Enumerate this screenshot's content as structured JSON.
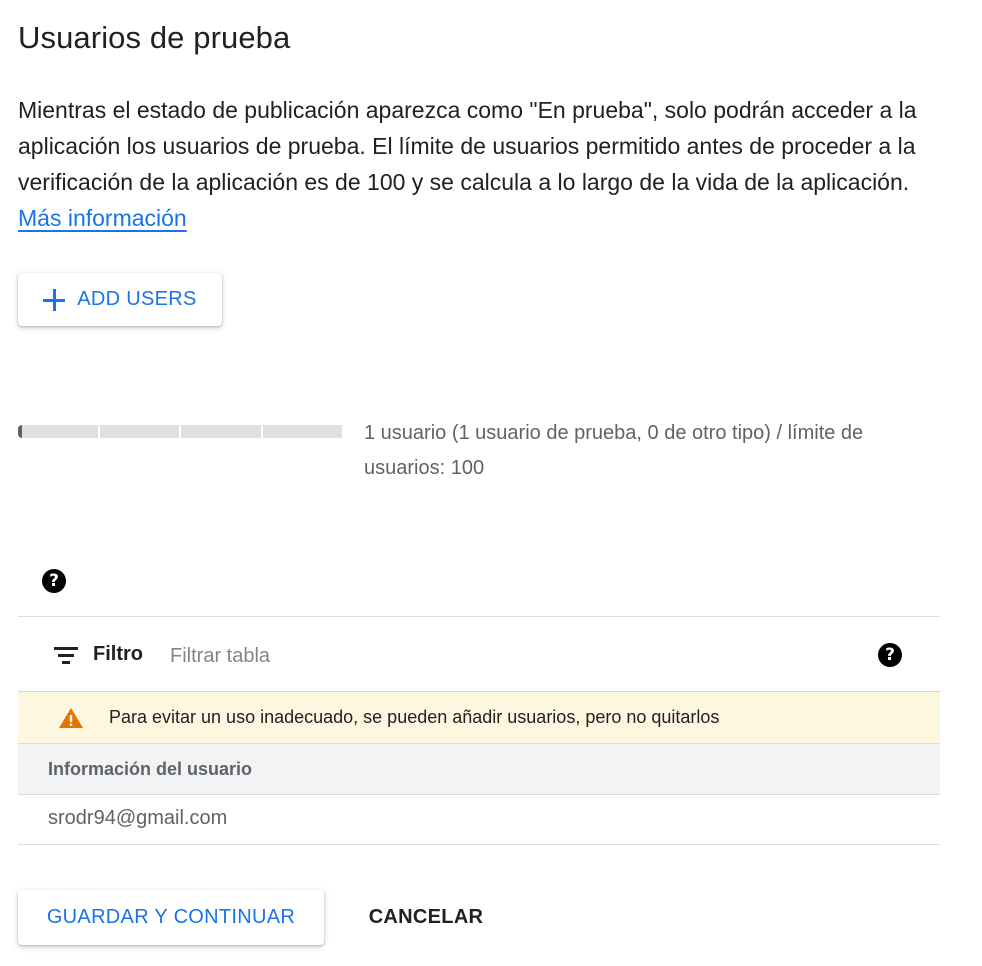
{
  "page": {
    "title": "Usuarios de prueba",
    "description": "Mientras el estado de publicación aparezca como \"En prueba\", solo podrán acceder a la aplicación los usuarios de prueba. El límite de usuarios permitido antes de proceder a la verificación de la aplicación es de 100 y se calcula a lo largo de la vida de la aplicación.",
    "learn_more_link": "Más información"
  },
  "actions": {
    "add_users_label": "ADD USERS",
    "add_users_icon": "plus-icon"
  },
  "usage": {
    "used": 1,
    "limit": 100,
    "text": "1 usuario (1 usuario de prueba, 0 de otro tipo) / límite de usuarios: 100"
  },
  "table": {
    "filter_label": "Filtro",
    "filter_placeholder": "Filtrar tabla",
    "filter_value": "",
    "warning": "Para evitar un uso inadecuado, se pueden añadir usuarios, pero no quitarlos",
    "columns": [
      "Información del usuario"
    ],
    "rows": [
      [
        "srodr94@gmail.com"
      ]
    ]
  },
  "footer": {
    "save_label": "GUARDAR Y CONTINUAR",
    "cancel_label": "CANCELAR"
  },
  "colors": {
    "accent": "#1a73e8",
    "warning_bg": "#fef7e0",
    "warning_icon": "#e37400",
    "header_bg": "#f1f3f4"
  }
}
